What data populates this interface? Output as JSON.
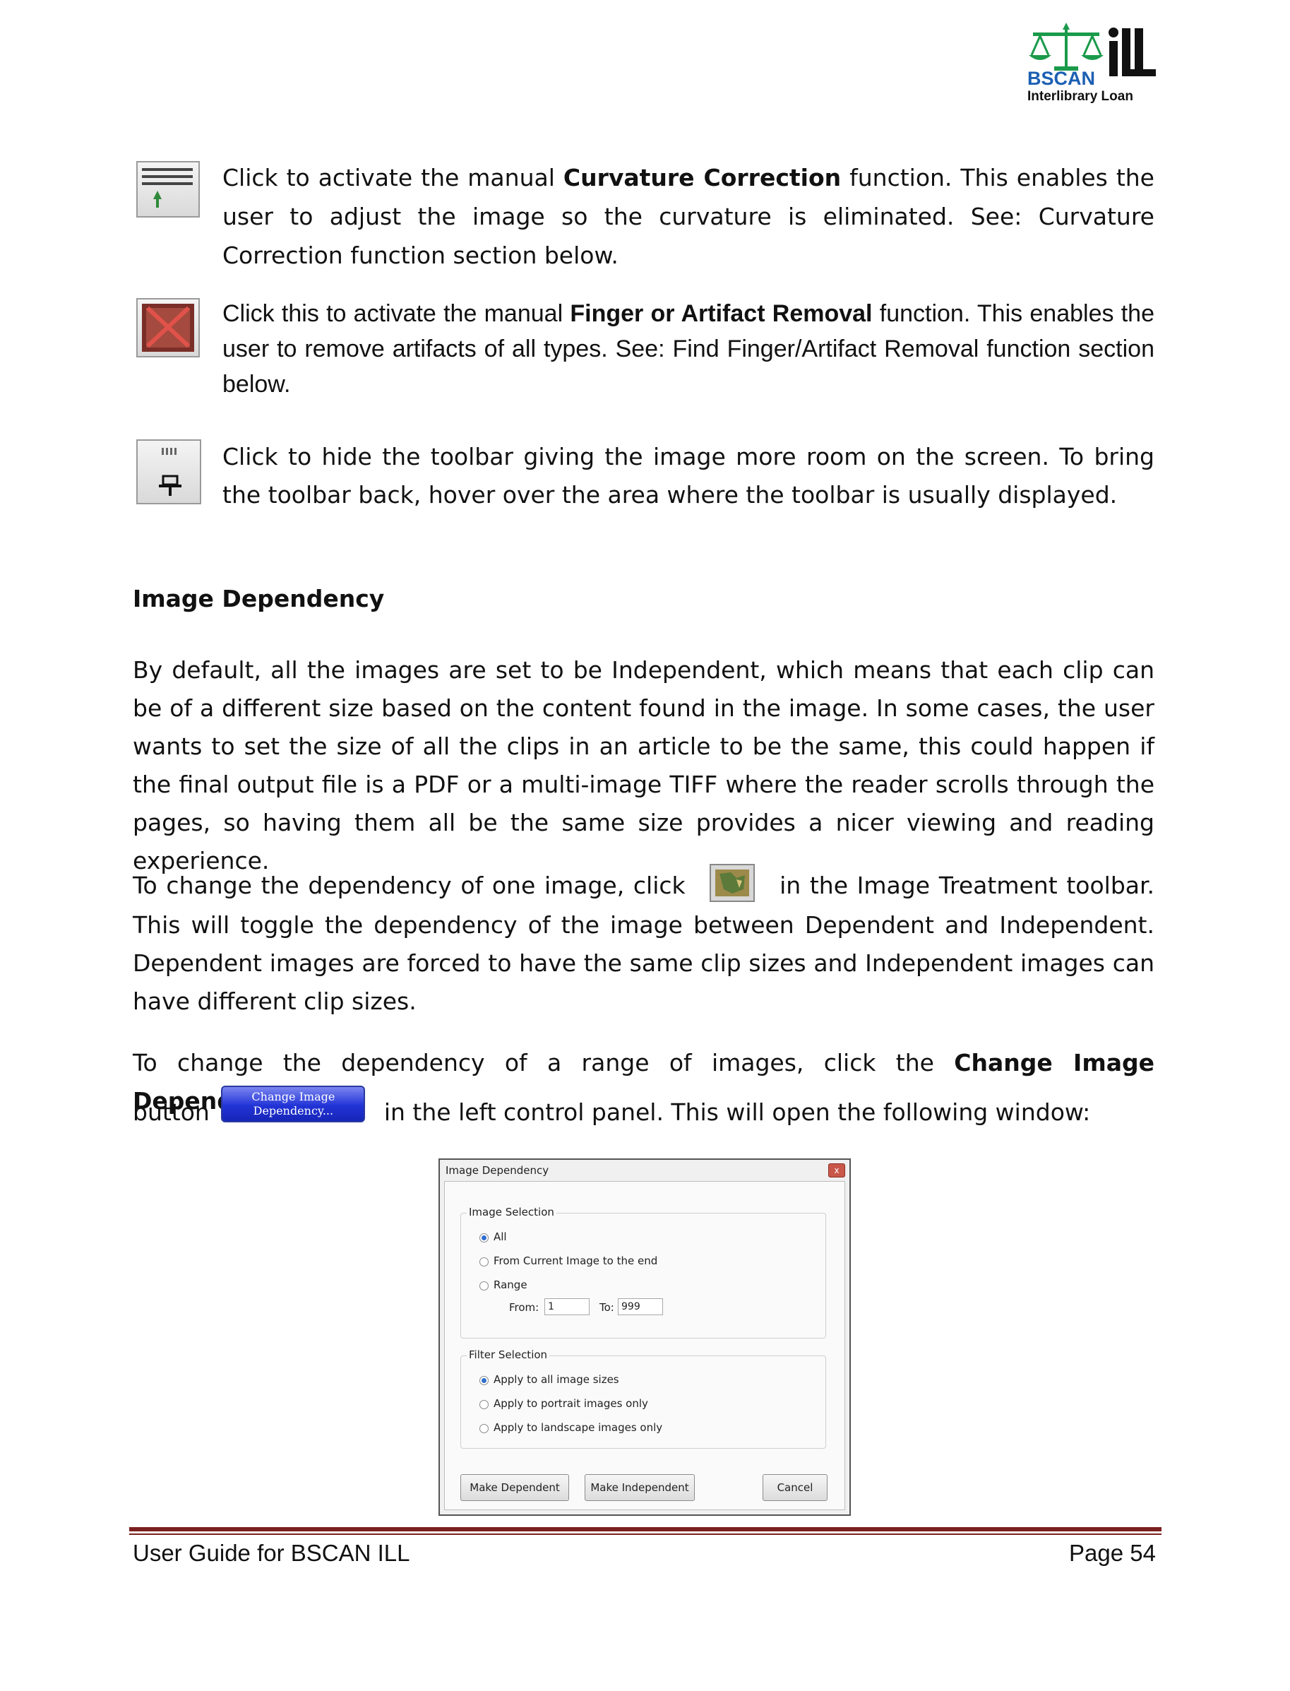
{
  "logo": {
    "name": "BSCAN",
    "mark": "iLL",
    "subtitle": "Interlibrary Loan",
    "colors": {
      "green": "#1a9a4a",
      "blue": "#1b5fb3",
      "black": "#111111"
    }
  },
  "tools": [
    {
      "icon": "curvature-correction-icon",
      "pre": "Click to activate the manual ",
      "bold": "Curvature Correction",
      "post": " function.  This enables the user to adjust the image so the curvature is eliminated.  See: Curvature Correction function section below."
    },
    {
      "icon": "finger-artifact-removal-icon",
      "pre": "Click this to activate the manual ",
      "bold": "Finger or Artifact Removal",
      "post": " function. This enables the user to remove artifacts of all types. See: Find Finger/Artifact Removal function section below."
    },
    {
      "icon": "hide-toolbar-pin-icon",
      "text": "Click to hide the toolbar giving the image more room on the screen. To bring the toolbar back, hover over the area where the toolbar is usually displayed."
    }
  ],
  "section_heading": "Image Dependency",
  "paragraphs": {
    "p1": "By default, all the images are set to be Independent, which means that each clip can be of a different size based on the content found in the image.  In some cases, the user wants to set the size of all the clips in an article to be the same, this could happen if the final output file is a PDF or a multi-image TIFF where the reader scrolls through the pages, so having them all be the same size provides a nicer viewing and reading experience.",
    "p2_pre": "To change the dependency of one image, click",
    "p2_post": "in the Image Treatment toolbar. This will toggle the dependency of the image between Dependent and Independent. Dependent images are forced to have the same clip sizes and Independent images can have different clip sizes.",
    "p3_pre": "To change the dependency of a range of images, click the ",
    "p3_bold": "Change Image Dependency",
    "p3_button_word": "button",
    "p3_post": "in the left control panel.  This will open the following window:"
  },
  "inline_button": {
    "line1": "Change Image",
    "line2": "Dependency..."
  },
  "dialog": {
    "title": "Image Dependency",
    "close": "x",
    "image_selection": {
      "legend": "Image Selection",
      "options": [
        "All",
        "From Current Image to the end",
        "Range"
      ],
      "selected": 0,
      "from_label": "From:",
      "from_value": "1",
      "to_label": "To:",
      "to_value": "999"
    },
    "filter_selection": {
      "legend": "Filter Selection",
      "options": [
        "Apply to all image sizes",
        "Apply to portrait images only",
        "Apply to landscape images only"
      ],
      "selected": 0
    },
    "buttons": {
      "make_dependent": "Make Dependent",
      "make_independent": "Make Independent",
      "cancel": "Cancel"
    }
  },
  "footer": {
    "left": "User Guide for BSCAN ILL",
    "right": "Page 54"
  }
}
